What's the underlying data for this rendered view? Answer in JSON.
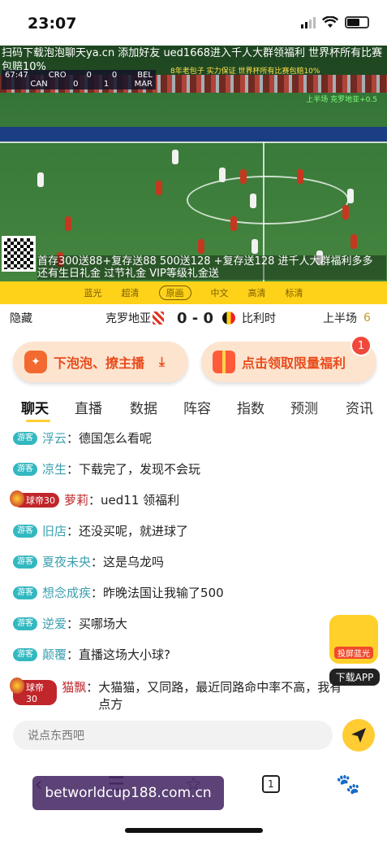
{
  "status": {
    "time": "23:07"
  },
  "video": {
    "ticker": "扫码下载泡泡聊天ya.cn 添加好友 ued1668进入千人大群领福利 世界杯所有比赛包赔10%",
    "score_line1": {
      "clock": "67:47",
      "home": "CRO",
      "home_score": "0",
      "away_score": "0",
      "away": "BEL"
    },
    "score_line2": {
      "home": "CAN",
      "home_score": "0",
      "away_score": "1",
      "away": "MAR"
    },
    "small_ad_1": "8年老包子 实力保证 世界杯所有比赛包赔10%",
    "small_ad_2": "上半场 克罗地亚+0.5",
    "promo": "首存300送88+复存送88 500送128 +复存送128 进千人大群福利多多 还有生日礼金 过节礼金 VIP等级礼金送"
  },
  "quality_options": [
    "蓝光",
    "超清",
    "原画",
    "中文",
    "高清",
    "标清"
  ],
  "quality_selected_index": 2,
  "match": {
    "hide_label": "隐藏",
    "team_home": "克罗地亚",
    "score": "0 - 0",
    "team_away": "比利时",
    "period": "上半场",
    "period_num": "6"
  },
  "banners": {
    "left_label": "下泡泡、撩主播",
    "left_icon": "download-icon",
    "right_label": "点击领取限量福利",
    "right_badge": "1"
  },
  "tabs": [
    "聊天",
    "直播",
    "数据",
    "阵容",
    "指数",
    "预测",
    "资讯"
  ],
  "active_tab": "聊天",
  "chat": [
    {
      "badge": "游客",
      "nick": "浮云",
      "text": "德国怎么看呢"
    },
    {
      "badge": "游客",
      "nick": "凉生",
      "text": "下载完了，发现不会玩"
    },
    {
      "badge": "球帝30",
      "nick": "萝莉",
      "text": "ued11 领福利",
      "vip": true
    },
    {
      "badge": "游客",
      "nick": "旧店",
      "text": "还没买呢，就进球了"
    },
    {
      "badge": "游客",
      "nick": "夏夜未央",
      "text": "这是乌龙吗"
    },
    {
      "badge": "游客",
      "nick": "想念成疾",
      "text": "昨晚法国让我输了500"
    },
    {
      "badge": "游客",
      "nick": "逆爱",
      "text": "买哪场大"
    },
    {
      "badge": "游客",
      "nick": "颠覆",
      "text": "直播这场大小球?"
    },
    {
      "badge": "球帝30",
      "nick": "猫飘",
      "text": "大猫猫，又同路，最近同路命中率不高，我有点方",
      "vip": true
    }
  ],
  "float_app": {
    "label": "投屏蓝光",
    "download": "下载APP"
  },
  "input": {
    "placeholder": "说点东西吧"
  },
  "nav": {
    "tab_count": "1"
  },
  "watermark": "betworldcup188.com.cn",
  "colors": {
    "accent": "#ffcc33",
    "orange": "#e84b1b",
    "guest": "#32b8c1",
    "vip": "#c0262a"
  }
}
